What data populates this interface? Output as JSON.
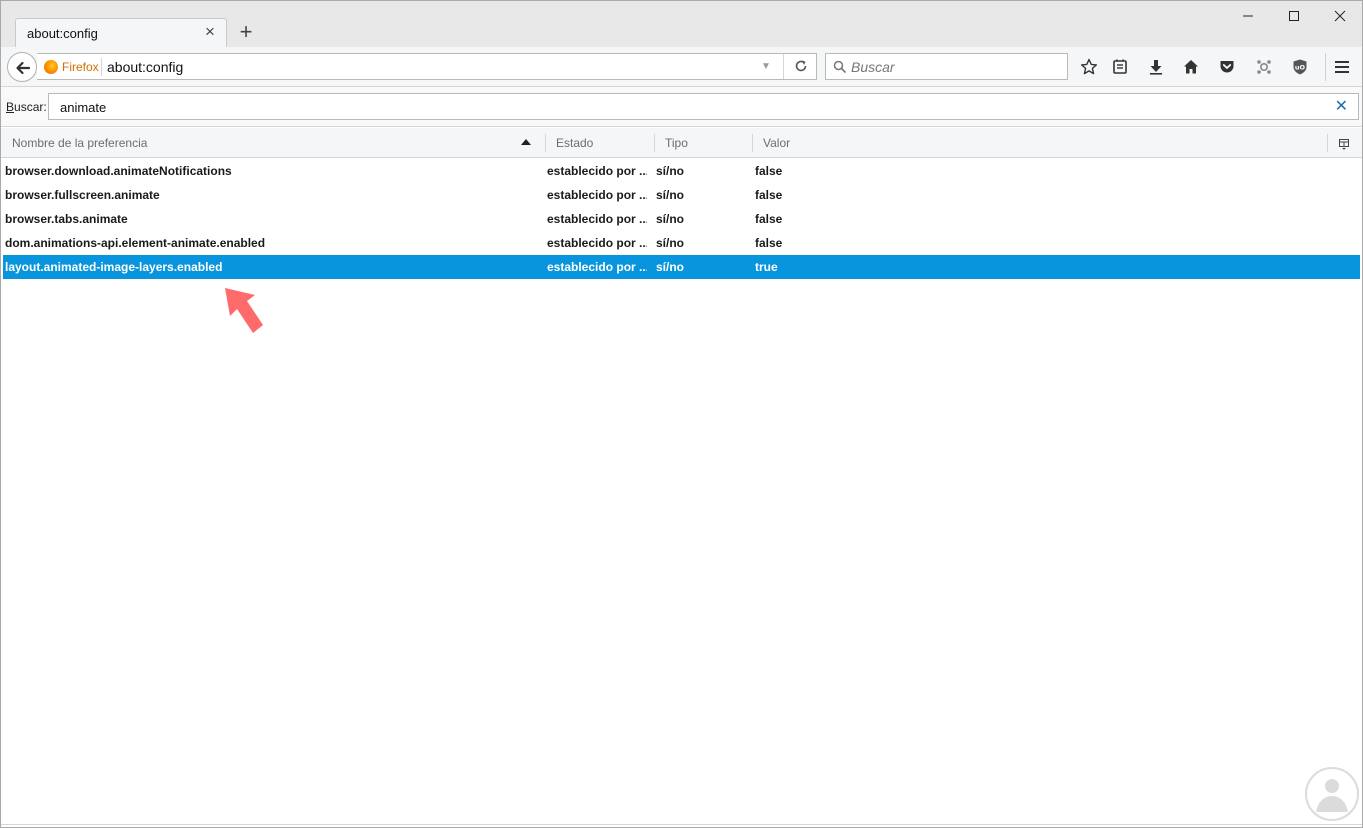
{
  "tab": {
    "title": "about:config"
  },
  "window_controls": {
    "minimize": "—",
    "maximize": "☐",
    "close": "✕"
  },
  "urlbar": {
    "identity_label": "Firefox",
    "url": "about:config"
  },
  "searchbar": {
    "placeholder": "Buscar"
  },
  "toolbar_icons": [
    "bookmark-star-icon",
    "reading-list-icon",
    "downloads-icon",
    "home-icon",
    "pocket-icon",
    "extension-icon",
    "ublock-icon",
    "menu-icon"
  ],
  "filter": {
    "label_access_key": "B",
    "label_rest": "uscar:",
    "value": "animate"
  },
  "columns": {
    "name": "Nombre de la preferencia",
    "state": "Estado",
    "type": "Tipo",
    "value": "Valor"
  },
  "rows": [
    {
      "name": "browser.download.animateNotifications",
      "state": "establecido por ...",
      "type": "sí/no",
      "value": "false",
      "selected": false
    },
    {
      "name": "browser.fullscreen.animate",
      "state": "establecido por ...",
      "type": "sí/no",
      "value": "false",
      "selected": false
    },
    {
      "name": "browser.tabs.animate",
      "state": "establecido por ...",
      "type": "sí/no",
      "value": "false",
      "selected": false
    },
    {
      "name": "dom.animations-api.element-animate.enabled",
      "state": "establecido por ...",
      "type": "sí/no",
      "value": "false",
      "selected": false
    },
    {
      "name": "layout.animated-image-layers.enabled",
      "state": "establecido por ...",
      "type": "sí/no",
      "value": "true",
      "selected": true
    }
  ],
  "colors": {
    "selection": "#0995de",
    "annotation_arrow": "#ff6b6b",
    "firefox_orange": "#e66000"
  }
}
